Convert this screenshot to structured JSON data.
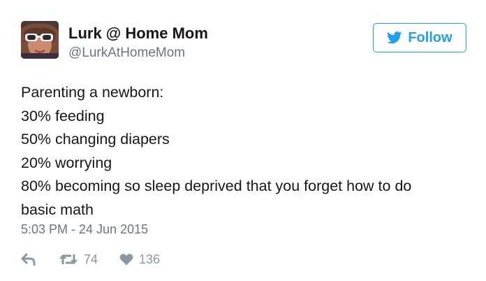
{
  "author": {
    "display_name": "Lurk @ Home Mom",
    "handle": "@LurkAtHomeMom",
    "avatar_icon": "profile-photo"
  },
  "follow_button": {
    "label": "Follow",
    "icon": "twitter-bird-icon",
    "color": "#1da1f2"
  },
  "tweet": {
    "lines": [
      "Parenting a newborn:",
      "30% feeding",
      "50% changing diapers",
      "20% worrying",
      "80% becoming so sleep deprived that you forget how to do",
      "basic math"
    ],
    "timestamp": "5:03 PM - 24 Jun 2015"
  },
  "actions": {
    "reply_icon": "reply-icon",
    "retweet_icon": "retweet-icon",
    "retweet_count": "74",
    "like_icon": "heart-icon",
    "like_count": "136",
    "icon_color": "#8899a6"
  }
}
